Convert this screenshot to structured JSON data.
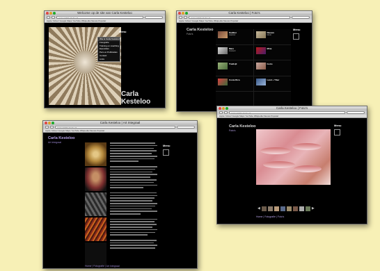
{
  "win_home": {
    "title": "Welcome op de site van Carla Kesteloo",
    "url": "www.carlakesteloo.nl",
    "bookmarks": "Apple Yahoo! Google Maps YouTube Wikipedia Nieuws Populair",
    "menu_label": "Menu",
    "menu_items": [
      "Wie is Carla Kesteloo?",
      "Fotografie",
      "Training en coaching",
      "Exposities",
      "Pers en Publicaties",
      "Contact",
      "Links"
    ],
    "name": "Carla Kesteloo"
  },
  "win_fotos": {
    "title": "Carla Kesteloo | Foto's",
    "url": "www.carlakesteloo.nl",
    "bookmarks": "Apple Yahoo! Google Maps YouTube Wikipedia Nieuws Populair",
    "name": "Carla Kesteloo",
    "subtitle": "Foto's",
    "menu_label": "Menu",
    "albums": [
      {
        "name": "Kadikoi",
        "place": "Istanbul",
        "colors": [
          "#7a4a3a",
          "#c99a6a"
        ]
      },
      {
        "name": "Nieuwe",
        "place": "Markt",
        "colors": [
          "#c6b89a",
          "#8a7a5a"
        ]
      },
      {
        "name": "Mare",
        "place": "Zeeland",
        "colors": [
          "#d8d8d8",
          "#6a6a6a"
        ]
      },
      {
        "name": "Mina",
        "place": "",
        "colors": [
          "#b81c1c",
          "#4a1c6a"
        ]
      },
      {
        "name": "Tradisjli",
        "place": "",
        "colors": [
          "#9ab47a",
          "#4a6a3a"
        ]
      },
      {
        "name": "Ivoire",
        "place": "",
        "colors": [
          "#c9a8a0",
          "#8a5c48"
        ]
      },
      {
        "name": "Costa Rica",
        "place": "",
        "colors": [
          "#d84040",
          "#3a6a3a"
        ]
      },
      {
        "name": "Land + Tiber",
        "place": "",
        "colors": [
          "#3a5a8a",
          "#9ab4d8"
        ]
      },
      {
        "name": "",
        "place": "",
        "colors": [
          "#050505",
          "#050505"
        ]
      },
      {
        "name": "",
        "place": "",
        "colors": [
          "#050505",
          "#050505"
        ]
      }
    ]
  },
  "win_integraal": {
    "title": "Carla Kesteloo | Art Integraal",
    "url": "www.carlakesteloo.nl",
    "bookmarks": "Apple Yahoo! Google Maps YouTube Wikipedia Nieuws Populair",
    "name": "Carla Kesteloo",
    "subtitle": "Art Integraal",
    "menu_label": "Menu",
    "caption": "Home | Fotografie | Art Integraal"
  },
  "win_detail": {
    "title": "Carla Kesteloo | Foto's",
    "url": "www.carlakesteloo.nl",
    "bookmarks": "Apple Yahoo! Google Maps YouTube Wikipedia Nieuws Populair",
    "name": "Carla Kesteloo",
    "subtitle": "Foto's",
    "menu_label": "Menu",
    "caption": "Home | Fotografie | Foto's",
    "strip_colors": [
      "#6a5a4a",
      "#8a7a6a",
      "#b89a7a",
      "#5a6a8a",
      "#9a8a6a",
      "#7a5a4a",
      "#aaaaaa",
      "#6a7a5a"
    ]
  }
}
